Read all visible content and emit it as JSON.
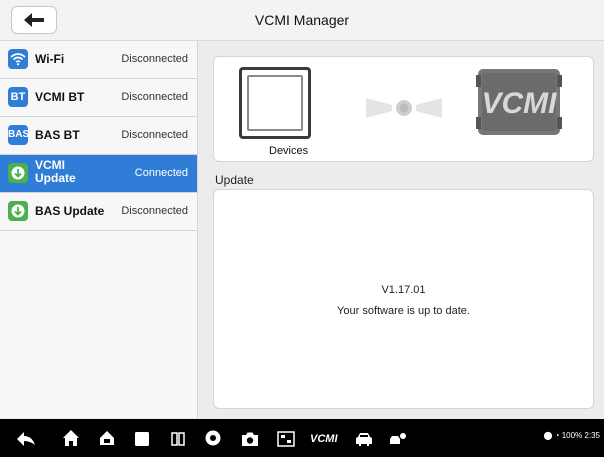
{
  "header": {
    "title": "VCMI Manager"
  },
  "sidebar": {
    "items": [
      {
        "icon": "wifi-icon",
        "icon_text": "",
        "icon_color": "#2f7dd6",
        "label": "Wi-Fi",
        "status": "Disconnected",
        "active": false
      },
      {
        "icon": "bt-icon",
        "icon_text": "BT",
        "icon_color": "#2f7dd6",
        "label": "VCMI BT",
        "status": "Disconnected",
        "active": false
      },
      {
        "icon": "bas-icon",
        "icon_text": "BAS",
        "icon_color": "#2f7dd6",
        "label": "BAS BT",
        "status": "Disconnected",
        "active": false
      },
      {
        "icon": "update-icon",
        "icon_text": "",
        "icon_color": "#4caf50",
        "label": "VCMI Update",
        "status": "Connected",
        "active": true
      },
      {
        "icon": "update-icon",
        "icon_text": "",
        "icon_color": "#4caf50",
        "label": "BAS Update",
        "status": "Disconnected",
        "active": false
      }
    ]
  },
  "devices": {
    "label": "Devices",
    "vcmi_logo": "VCMI"
  },
  "update": {
    "header": "Update",
    "version": "V1.17.01",
    "message": "Your software is up to date."
  },
  "navbar": {
    "vcmi_label": "VCMI",
    "status_text": "100% 2:35"
  }
}
